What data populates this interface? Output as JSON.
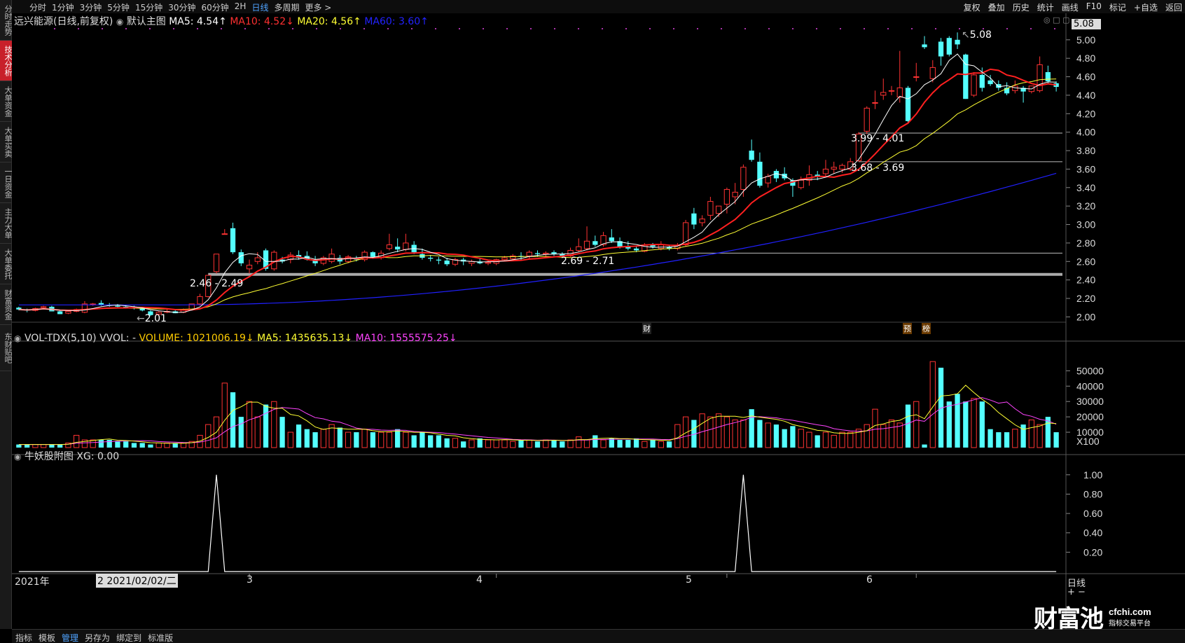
{
  "sidebar": [
    "分时走势",
    "技术分析",
    "大单资金",
    "大单买卖",
    "一日资金",
    "主力大单",
    "大单委托",
    "财富资金",
    "东财贴吧"
  ],
  "sidebar_active": 1,
  "periods": [
    "分时",
    "1分钟",
    "3分钟",
    "5分钟",
    "15分钟",
    "30分钟",
    "60分钟",
    "2H",
    "日线",
    "多周期",
    "更多 >"
  ],
  "period_active": 8,
  "toolbar": [
    "复权",
    "叠加",
    "历史",
    "统计",
    "画线",
    "F10",
    "标记",
    "+自选",
    "返回"
  ],
  "price_header": {
    "name": "远兴能源(日线,前复权)",
    "main": "默认主图",
    "ma5": "MA5: 4.54↑",
    "ma10": "MA10: 4.52↓",
    "ma20": "MA20: 4.56↑",
    "ma60": "MA60: 3.60↑",
    "last_price": "5.08"
  },
  "vol_header": {
    "name": "VOL-TDX(5,10) VVOL: -",
    "volume": "VOLUME: 1021006.19↓",
    "ma5": "MA5: 1435635.13↓",
    "ma10": "MA10: 1555575.25↓"
  },
  "ind_header": {
    "name": "牛妖股附图 XG: 0.00"
  },
  "annotations": {
    "high": "5.08",
    "low": "2.01",
    "gap1": "2.46 - 2.49",
    "gap2": "2.69 - 2.71",
    "gap3": "3.68 - 3.69",
    "gap4": "3.99 - 4.01",
    "event_cai": "财",
    "event_yu": "预",
    "event_bang": "榜"
  },
  "date_axis": {
    "year": "2021年",
    "cursor": "2 2021/02/02/二",
    "months": [
      "3",
      "4",
      "5",
      "6"
    ],
    "unit": "日线"
  },
  "bottom_tabs": [
    "指标",
    "模板",
    "管理",
    "另存为",
    "绑定到",
    "标准版"
  ],
  "bottom_active": 2,
  "watermark": {
    "logo": "财富池",
    "domain": "cfchi.com",
    "sub": "指标交易平台"
  },
  "chart_data": {
    "type": "candlestick",
    "colors": {
      "up": "#ff3333",
      "down": "#54ffff",
      "ma5": "#ffffff",
      "ma10": "#ff2020",
      "ma20": "#ffff33",
      "ma60": "#2020ff",
      "vma10": "#ff44ff"
    },
    "price_axis": {
      "ticks": [
        "5.00",
        "4.80",
        "4.60",
        "4.40",
        "4.20",
        "4.00",
        "3.80",
        "3.60",
        "3.40",
        "3.20",
        "3.00",
        "2.80",
        "2.60",
        "2.40",
        "2.20",
        "2.00"
      ],
      "ylim": [
        1.95,
        5.12
      ]
    },
    "volume_axis": {
      "ticks": [
        "50000",
        "40000",
        "30000",
        "20000",
        "10000"
      ],
      "unit": "X100",
      "ylim": [
        0,
        57000
      ]
    },
    "indicator_axis": {
      "ticks": [
        "1.00",
        "0.80",
        "0.60",
        "0.40",
        "0.20"
      ],
      "ylim": [
        0,
        1.1
      ]
    },
    "ohlc": [
      [
        2.1,
        2.11,
        2.07,
        2.08
      ],
      [
        2.08,
        2.09,
        2.05,
        2.07
      ],
      [
        2.07,
        2.1,
        2.06,
        2.09
      ],
      [
        2.1,
        2.12,
        2.08,
        2.11
      ],
      [
        2.11,
        2.12,
        2.06,
        2.06
      ],
      [
        2.06,
        2.07,
        2.03,
        2.03
      ],
      [
        2.04,
        2.07,
        2.03,
        2.06
      ],
      [
        2.06,
        2.09,
        2.05,
        2.08
      ],
      [
        2.05,
        2.17,
        2.04,
        2.14
      ],
      [
        2.14,
        2.15,
        2.12,
        2.14
      ],
      [
        2.15,
        2.18,
        2.12,
        2.13
      ],
      [
        2.13,
        2.15,
        2.11,
        2.12
      ],
      [
        2.12,
        2.14,
        2.1,
        2.11
      ],
      [
        2.11,
        2.13,
        2.09,
        2.1
      ],
      [
        2.1,
        2.12,
        2.08,
        2.09
      ],
      [
        2.09,
        2.1,
        2.06,
        2.07
      ],
      [
        2.06,
        2.07,
        2.01,
        2.02
      ],
      [
        2.03,
        2.06,
        2.02,
        2.05
      ],
      [
        2.05,
        2.08,
        2.04,
        2.06
      ],
      [
        2.06,
        2.07,
        2.04,
        2.04
      ],
      [
        2.05,
        2.09,
        2.04,
        2.08
      ],
      [
        2.08,
        2.14,
        2.08,
        2.14
      ],
      [
        2.14,
        2.25,
        2.12,
        2.22
      ],
      [
        2.22,
        2.45,
        2.21,
        2.45
      ],
      [
        2.49,
        2.68,
        2.47,
        2.68
      ],
      [
        2.9,
        2.95,
        2.9,
        2.9
      ],
      [
        2.96,
        3.02,
        2.68,
        2.7
      ],
      [
        2.7,
        2.73,
        2.55,
        2.58
      ],
      [
        2.52,
        2.62,
        2.47,
        2.56
      ],
      [
        2.6,
        2.7,
        2.57,
        2.64
      ],
      [
        2.72,
        2.74,
        2.5,
        2.52
      ],
      [
        2.52,
        2.72,
        2.5,
        2.7
      ],
      [
        2.62,
        2.65,
        2.58,
        2.6
      ],
      [
        2.62,
        2.7,
        2.58,
        2.67
      ],
      [
        2.67,
        2.72,
        2.62,
        2.64
      ],
      [
        2.66,
        2.71,
        2.61,
        2.62
      ],
      [
        2.62,
        2.66,
        2.55,
        2.58
      ],
      [
        2.58,
        2.66,
        2.56,
        2.64
      ],
      [
        2.6,
        2.74,
        2.58,
        2.68
      ],
      [
        2.64,
        2.67,
        2.57,
        2.6
      ],
      [
        2.6,
        2.67,
        2.58,
        2.65
      ],
      [
        2.64,
        2.66,
        2.6,
        2.62
      ],
      [
        2.62,
        2.72,
        2.6,
        2.7
      ],
      [
        2.7,
        2.71,
        2.63,
        2.65
      ],
      [
        2.64,
        2.72,
        2.62,
        2.69
      ],
      [
        2.74,
        2.9,
        2.72,
        2.78
      ],
      [
        2.76,
        2.85,
        2.7,
        2.73
      ],
      [
        2.73,
        2.9,
        2.71,
        2.8
      ],
      [
        2.78,
        2.82,
        2.68,
        2.7
      ],
      [
        2.68,
        2.74,
        2.62,
        2.64
      ],
      [
        2.64,
        2.67,
        2.6,
        2.63
      ],
      [
        2.62,
        2.65,
        2.57,
        2.61
      ],
      [
        2.61,
        2.64,
        2.55,
        2.57
      ],
      [
        2.57,
        2.64,
        2.55,
        2.62
      ],
      [
        2.62,
        2.64,
        2.56,
        2.6
      ],
      [
        2.58,
        2.62,
        2.55,
        2.6
      ],
      [
        2.6,
        2.63,
        2.57,
        2.58
      ],
      [
        2.58,
        2.61,
        2.56,
        2.59
      ],
      [
        2.58,
        2.63,
        2.56,
        2.62
      ],
      [
        2.62,
        2.66,
        2.6,
        2.64
      ],
      [
        2.63,
        2.68,
        2.61,
        2.66
      ],
      [
        2.66,
        2.7,
        2.62,
        2.65
      ],
      [
        2.66,
        2.72,
        2.63,
        2.7
      ],
      [
        2.69,
        2.72,
        2.65,
        2.68
      ],
      [
        2.68,
        2.71,
        2.64,
        2.69
      ],
      [
        2.7,
        2.72,
        2.66,
        2.68
      ],
      [
        2.68,
        2.7,
        2.64,
        2.66
      ],
      [
        2.66,
        2.75,
        2.65,
        2.72
      ],
      [
        2.72,
        2.85,
        2.7,
        2.76
      ],
      [
        2.74,
        2.98,
        2.72,
        2.82
      ],
      [
        2.82,
        2.88,
        2.76,
        2.78
      ],
      [
        2.78,
        2.92,
        2.76,
        2.88
      ],
      [
        2.86,
        2.95,
        2.8,
        2.82
      ],
      [
        2.82,
        2.86,
        2.74,
        2.76
      ],
      [
        2.76,
        2.82,
        2.72,
        2.74
      ],
      [
        2.74,
        2.76,
        2.7,
        2.72
      ],
      [
        2.71,
        2.8,
        2.7,
        2.78
      ],
      [
        2.78,
        2.8,
        2.74,
        2.76
      ],
      [
        2.74,
        2.82,
        2.72,
        2.78
      ],
      [
        2.76,
        2.78,
        2.72,
        2.74
      ],
      [
        2.74,
        2.8,
        2.72,
        2.77
      ],
      [
        2.78,
        3.05,
        2.76,
        3.02
      ],
      [
        3.12,
        3.18,
        2.95,
        3.0
      ],
      [
        3.02,
        3.1,
        2.98,
        3.06
      ],
      [
        3.1,
        3.3,
        3.05,
        3.25
      ],
      [
        3.12,
        3.2,
        3.08,
        3.2
      ],
      [
        3.22,
        3.4,
        3.12,
        3.38
      ],
      [
        3.3,
        3.45,
        3.22,
        3.35
      ],
      [
        3.38,
        3.65,
        3.3,
        3.62
      ],
      [
        3.8,
        3.92,
        3.68,
        3.7
      ],
      [
        3.68,
        3.78,
        3.4,
        3.42
      ],
      [
        3.45,
        3.55,
        3.4,
        3.52
      ],
      [
        3.58,
        3.6,
        3.46,
        3.5
      ],
      [
        3.55,
        3.62,
        3.48,
        3.5
      ],
      [
        3.48,
        3.5,
        3.3,
        3.42
      ],
      [
        3.4,
        3.52,
        3.38,
        3.48
      ],
      [
        3.48,
        3.64,
        3.42,
        3.54
      ],
      [
        3.54,
        3.58,
        3.48,
        3.52
      ],
      [
        3.55,
        3.7,
        3.52,
        3.6
      ],
      [
        3.6,
        3.68,
        3.55,
        3.62
      ],
      [
        3.6,
        3.66,
        3.56,
        3.64
      ],
      [
        3.6,
        3.72,
        3.58,
        3.68
      ],
      [
        3.69,
        4.0,
        3.68,
        3.98
      ],
      [
        4.01,
        4.28,
        3.98,
        4.26
      ],
      [
        4.32,
        4.45,
        4.25,
        4.32
      ],
      [
        4.4,
        4.58,
        4.35,
        4.43
      ],
      [
        4.45,
        4.5,
        4.4,
        4.45
      ],
      [
        4.38,
        4.88,
        4.32,
        4.48
      ],
      [
        4.48,
        4.5,
        4.1,
        4.12
      ],
      [
        4.6,
        4.75,
        4.55,
        4.6
      ],
      [
        4.95,
        5.04,
        4.9,
        4.92
      ],
      [
        4.58,
        4.78,
        4.54,
        4.7
      ],
      [
        4.98,
        5.02,
        4.72,
        4.82
      ],
      [
        5.02,
        5.04,
        4.82,
        4.84
      ],
      [
        5.0,
        5.08,
        4.9,
        4.95
      ],
      [
        4.84,
        4.85,
        4.36,
        4.36
      ],
      [
        4.4,
        4.65,
        4.38,
        4.62
      ],
      [
        4.62,
        4.7,
        4.44,
        4.48
      ],
      [
        4.56,
        4.62,
        4.5,
        4.52
      ],
      [
        4.52,
        4.56,
        4.45,
        4.48
      ],
      [
        4.48,
        4.54,
        4.4,
        4.42
      ],
      [
        4.45,
        4.56,
        4.42,
        4.5
      ],
      [
        4.48,
        4.5,
        4.32,
        4.44
      ],
      [
        4.44,
        4.5,
        4.42,
        4.5
      ],
      [
        4.45,
        4.82,
        4.43,
        4.73
      ],
      [
        4.65,
        4.72,
        4.52,
        4.55
      ],
      [
        4.53,
        4.55,
        4.44,
        4.49
      ]
    ],
    "volume_k": [
      2,
      2,
      2,
      2,
      2,
      2,
      3,
      8,
      5,
      5,
      5,
      5,
      4,
      4,
      3,
      3,
      2,
      3,
      3,
      3,
      3,
      4,
      8,
      15,
      20,
      42,
      36,
      20,
      30,
      20,
      28,
      30,
      20,
      10,
      15,
      12,
      10,
      12,
      15,
      13,
      10,
      10,
      12,
      10,
      10,
      10,
      12,
      10,
      8,
      10,
      8,
      8,
      6,
      6,
      4,
      5,
      6,
      5,
      5,
      5,
      4,
      5,
      5,
      4,
      5,
      5,
      4,
      5,
      7,
      5,
      8,
      5,
      6,
      5,
      5,
      6,
      4,
      5,
      4,
      4,
      15,
      20,
      18,
      22,
      20,
      22,
      20,
      18,
      18,
      25,
      18,
      16,
      15,
      12,
      14,
      12,
      10,
      8,
      10,
      8,
      10,
      10,
      12,
      15,
      25,
      15,
      18,
      16,
      28,
      30,
      2,
      56,
      52,
      30,
      35,
      30,
      32,
      30,
      12,
      10,
      10,
      12,
      15,
      18,
      15,
      20,
      10
    ],
    "xg_spikes": [
      24,
      88
    ],
    "support_lines": [
      2.46,
      2.69,
      3.68,
      3.99
    ]
  }
}
